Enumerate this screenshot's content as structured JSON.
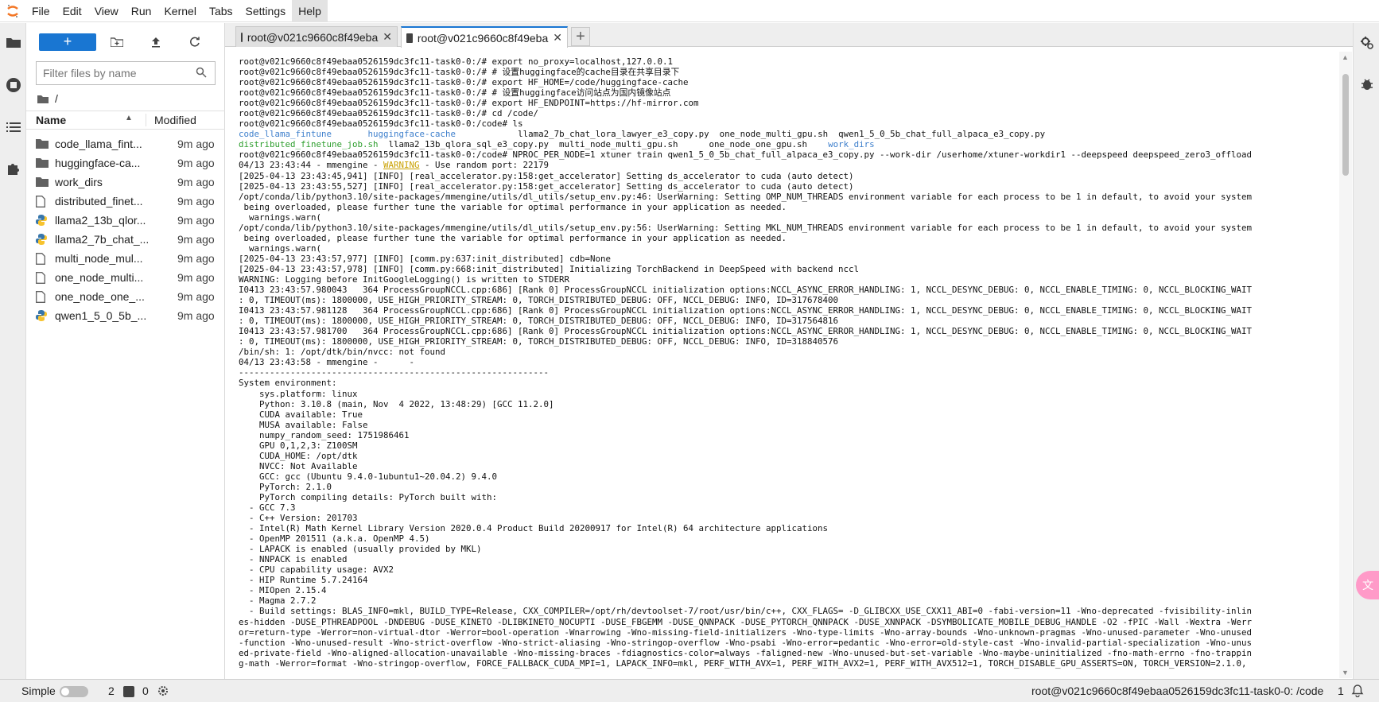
{
  "menu": [
    "File",
    "Edit",
    "View",
    "Run",
    "Kernel",
    "Tabs",
    "Settings",
    "Help"
  ],
  "filebrowser": {
    "new_label": "+",
    "filter_placeholder": "Filter files by name",
    "breadcrumb": "/",
    "col_name": "Name",
    "col_modified": "Modified",
    "files": [
      {
        "name": "code_llama_fint...",
        "time": "9m ago",
        "icon": "folder-icon"
      },
      {
        "name": "huggingface-ca...",
        "time": "9m ago",
        "icon": "folder-icon"
      },
      {
        "name": "work_dirs",
        "time": "9m ago",
        "icon": "folder-icon"
      },
      {
        "name": "distributed_finet...",
        "time": "9m ago",
        "icon": "file-icon"
      },
      {
        "name": "llama2_13b_qlor...",
        "time": "9m ago",
        "icon": "python-icon"
      },
      {
        "name": "llama2_7b_chat_...",
        "time": "9m ago",
        "icon": "python-icon"
      },
      {
        "name": "multi_node_mul...",
        "time": "9m ago",
        "icon": "file-icon"
      },
      {
        "name": "one_node_multi...",
        "time": "9m ago",
        "icon": "file-icon"
      },
      {
        "name": "one_node_one_...",
        "time": "9m ago",
        "icon": "file-icon"
      },
      {
        "name": "qwen1_5_0_5b_...",
        "time": "9m ago",
        "icon": "python-icon"
      }
    ]
  },
  "tabs": [
    {
      "label": "root@v021c9660c8f49eba",
      "active": false
    },
    {
      "label": "root@v021c9660c8f49eba",
      "active": true
    }
  ],
  "terminal": {
    "lines_a": [
      "root@v021c9660c8f49ebaa0526159dc3fc11-task0-0:/# export no_proxy=localhost,127.0.0.1",
      "root@v021c9660c8f49ebaa0526159dc3fc11-task0-0:/# # 设置huggingface的cache目录在共享目录下",
      "root@v021c9660c8f49ebaa0526159dc3fc11-task0-0:/# export HF_HOME=/code/huggingface-cache",
      "root@v021c9660c8f49ebaa0526159dc3fc11-task0-0:/# # 设置huggingface访问站点为国内镜像站点",
      "root@v021c9660c8f49ebaa0526159dc3fc11-task0-0:/# export HF_ENDPOINT=https://hf-mirror.com",
      "root@v021c9660c8f49ebaa0526159dc3fc11-task0-0:/# cd /code/",
      "root@v021c9660c8f49ebaa0526159dc3fc11-task0-0:/code# ls"
    ],
    "ls_row1": {
      "d1": "code_llama_fintune",
      "d2": "huggingface-cache",
      "rest": "llama2_7b_chat_lora_lawyer_e3_copy.py  one_node_multi_gpu.sh  qwen1_5_0_5b_chat_full_alpaca_e3_copy.py"
    },
    "ls_row2": {
      "f1": "distributed_finetune_job.sh",
      "mid": "llama2_13b_qlora_sql_e3_copy.py  multi_node_multi_gpu.sh      one_node_one_gpu.sh    ",
      "d3": "work_dirs"
    },
    "cmd_line": "root@v021c9660c8f49ebaa0526159dc3fc11-task0-0:/code# NPROC_PER_NODE=1 xtuner train qwen1_5_0_5b_chat_full_alpaca_e3_copy.py --work-dir /userhome/xtuner-workdir1 --deepspeed deepspeed_zero3_offload",
    "warn_prefix": "04/13 23:43:44 - mmengine - ",
    "warn_word": "WARNING",
    "warn_suffix": " - Use random port: 22179",
    "lines_b": [
      "[2025-04-13 23:43:45,941] [INFO] [real_accelerator.py:158:get_accelerator] Setting ds_accelerator to cuda (auto detect)",
      "[2025-04-13 23:43:55,527] [INFO] [real_accelerator.py:158:get_accelerator] Setting ds_accelerator to cuda (auto detect)",
      "/opt/conda/lib/python3.10/site-packages/mmengine/utils/dl_utils/setup_env.py:46: UserWarning: Setting OMP_NUM_THREADS environment variable for each process to be 1 in default, to avoid your system",
      " being overloaded, please further tune the variable for optimal performance in your application as needed.",
      "  warnings.warn(",
      "/opt/conda/lib/python3.10/site-packages/mmengine/utils/dl_utils/setup_env.py:56: UserWarning: Setting MKL_NUM_THREADS environment variable for each process to be 1 in default, to avoid your system",
      " being overloaded, please further tune the variable for optimal performance in your application as needed.",
      "  warnings.warn(",
      "[2025-04-13 23:43:57,977] [INFO] [comm.py:637:init_distributed] cdb=None",
      "[2025-04-13 23:43:57,978] [INFO] [comm.py:668:init_distributed] Initializing TorchBackend in DeepSpeed with backend nccl",
      "WARNING: Logging before InitGoogleLogging() is written to STDERR",
      "I0413 23:43:57.980043   364 ProcessGroupNCCL.cpp:686] [Rank 0] ProcessGroupNCCL initialization options:NCCL_ASYNC_ERROR_HANDLING: 1, NCCL_DESYNC_DEBUG: 0, NCCL_ENABLE_TIMING: 0, NCCL_BLOCKING_WAIT",
      ": 0, TIMEOUT(ms): 1800000, USE_HIGH_PRIORITY_STREAM: 0, TORCH_DISTRIBUTED_DEBUG: OFF, NCCL_DEBUG: INFO, ID=317678400",
      "I0413 23:43:57.981128   364 ProcessGroupNCCL.cpp:686] [Rank 0] ProcessGroupNCCL initialization options:NCCL_ASYNC_ERROR_HANDLING: 1, NCCL_DESYNC_DEBUG: 0, NCCL_ENABLE_TIMING: 0, NCCL_BLOCKING_WAIT",
      ": 0, TIMEOUT(ms): 1800000, USE_HIGH_PRIORITY_STREAM: 0, TORCH_DISTRIBUTED_DEBUG: OFF, NCCL_DEBUG: INFO, ID=317564816",
      "I0413 23:43:57.981700   364 ProcessGroupNCCL.cpp:686] [Rank 0] ProcessGroupNCCL initialization options:NCCL_ASYNC_ERROR_HANDLING: 1, NCCL_DESYNC_DEBUG: 0, NCCL_ENABLE_TIMING: 0, NCCL_BLOCKING_WAIT",
      ": 0, TIMEOUT(ms): 1800000, USE_HIGH_PRIORITY_STREAM: 0, TORCH_DISTRIBUTED_DEBUG: OFF, NCCL_DEBUG: INFO, ID=318840576",
      "/bin/sh: 1: /opt/dtk/bin/nvcc: not found",
      "04/13 23:43:58 - mmengine -      -",
      "------------------------------------------------------------",
      "System environment:",
      "    sys.platform: linux",
      "    Python: 3.10.8 (main, Nov  4 2022, 13:48:29) [GCC 11.2.0]",
      "    CUDA available: True",
      "    MUSA available: False",
      "    numpy_random_seed: 1751986461",
      "    GPU 0,1,2,3: Z100SM",
      "    CUDA_HOME: /opt/dtk",
      "    NVCC: Not Available",
      "    GCC: gcc (Ubuntu 9.4.0-1ubuntu1~20.04.2) 9.4.0",
      "    PyTorch: 2.1.0",
      "    PyTorch compiling details: PyTorch built with:",
      "  - GCC 7.3",
      "  - C++ Version: 201703",
      "  - Intel(R) Math Kernel Library Version 2020.0.4 Product Build 20200917 for Intel(R) 64 architecture applications",
      "  - OpenMP 201511 (a.k.a. OpenMP 4.5)",
      "  - LAPACK is enabled (usually provided by MKL)",
      "  - NNPACK is enabled",
      "  - CPU capability usage: AVX2",
      "  - HIP Runtime 5.7.24164",
      "  - MIOpen 2.15.4",
      "  - Magma 2.7.2",
      "  - Build settings: BLAS_INFO=mkl, BUILD_TYPE=Release, CXX_COMPILER=/opt/rh/devtoolset-7/root/usr/bin/c++, CXX_FLAGS= -D_GLIBCXX_USE_CXX11_ABI=0 -fabi-version=11 -Wno-deprecated -fvisibility-inlin",
      "es-hidden -DUSE_PTHREADPOOL -DNDEBUG -DUSE_KINETO -DLIBKINETO_NOCUPTI -DUSE_FBGEMM -DUSE_QNNPACK -DUSE_PYTORCH_QNNPACK -DUSE_XNNPACK -DSYMBOLICATE_MOBILE_DEBUG_HANDLE -O2 -fPIC -Wall -Wextra -Werr",
      "or=return-type -Werror=non-virtual-dtor -Werror=bool-operation -Wnarrowing -Wno-missing-field-initializers -Wno-type-limits -Wno-array-bounds -Wno-unknown-pragmas -Wno-unused-parameter -Wno-unused",
      "-function -Wno-unused-result -Wno-strict-overflow -Wno-strict-aliasing -Wno-stringop-overflow -Wno-psabi -Wno-error=pedantic -Wno-error=old-style-cast -Wno-invalid-partial-specialization -Wno-unus",
      "ed-private-field -Wno-aligned-allocation-unavailable -Wno-missing-braces -fdiagnostics-color=always -faligned-new -Wno-unused-but-set-variable -Wno-maybe-uninitialized -fno-math-errno -fno-trappin",
      "g-math -Werror=format -Wno-stringop-overflow, FORCE_FALLBACK_CUDA_MPI=1, LAPACK_INFO=mkl, PERF_WITH_AVX=1, PERF_WITH_AVX2=1, PERF_WITH_AVX512=1, TORCH_DISABLE_GPU_ASSERTS=ON, TORCH_VERSION=2.1.0,"
    ]
  },
  "status": {
    "simple_label": "Simple",
    "count_terminals": "2",
    "count_kernels": "0",
    "path": "root@v021c9660c8f49ebaa0526159dc3fc11-task0-0: /code",
    "right_count": "1"
  },
  "colors": {
    "accent": "#1976d2",
    "dir_blue": "#3d7fcc",
    "exec_green": "#2e9e2e",
    "warn_yellow": "#c9a000",
    "folder_gray": "#616161"
  }
}
